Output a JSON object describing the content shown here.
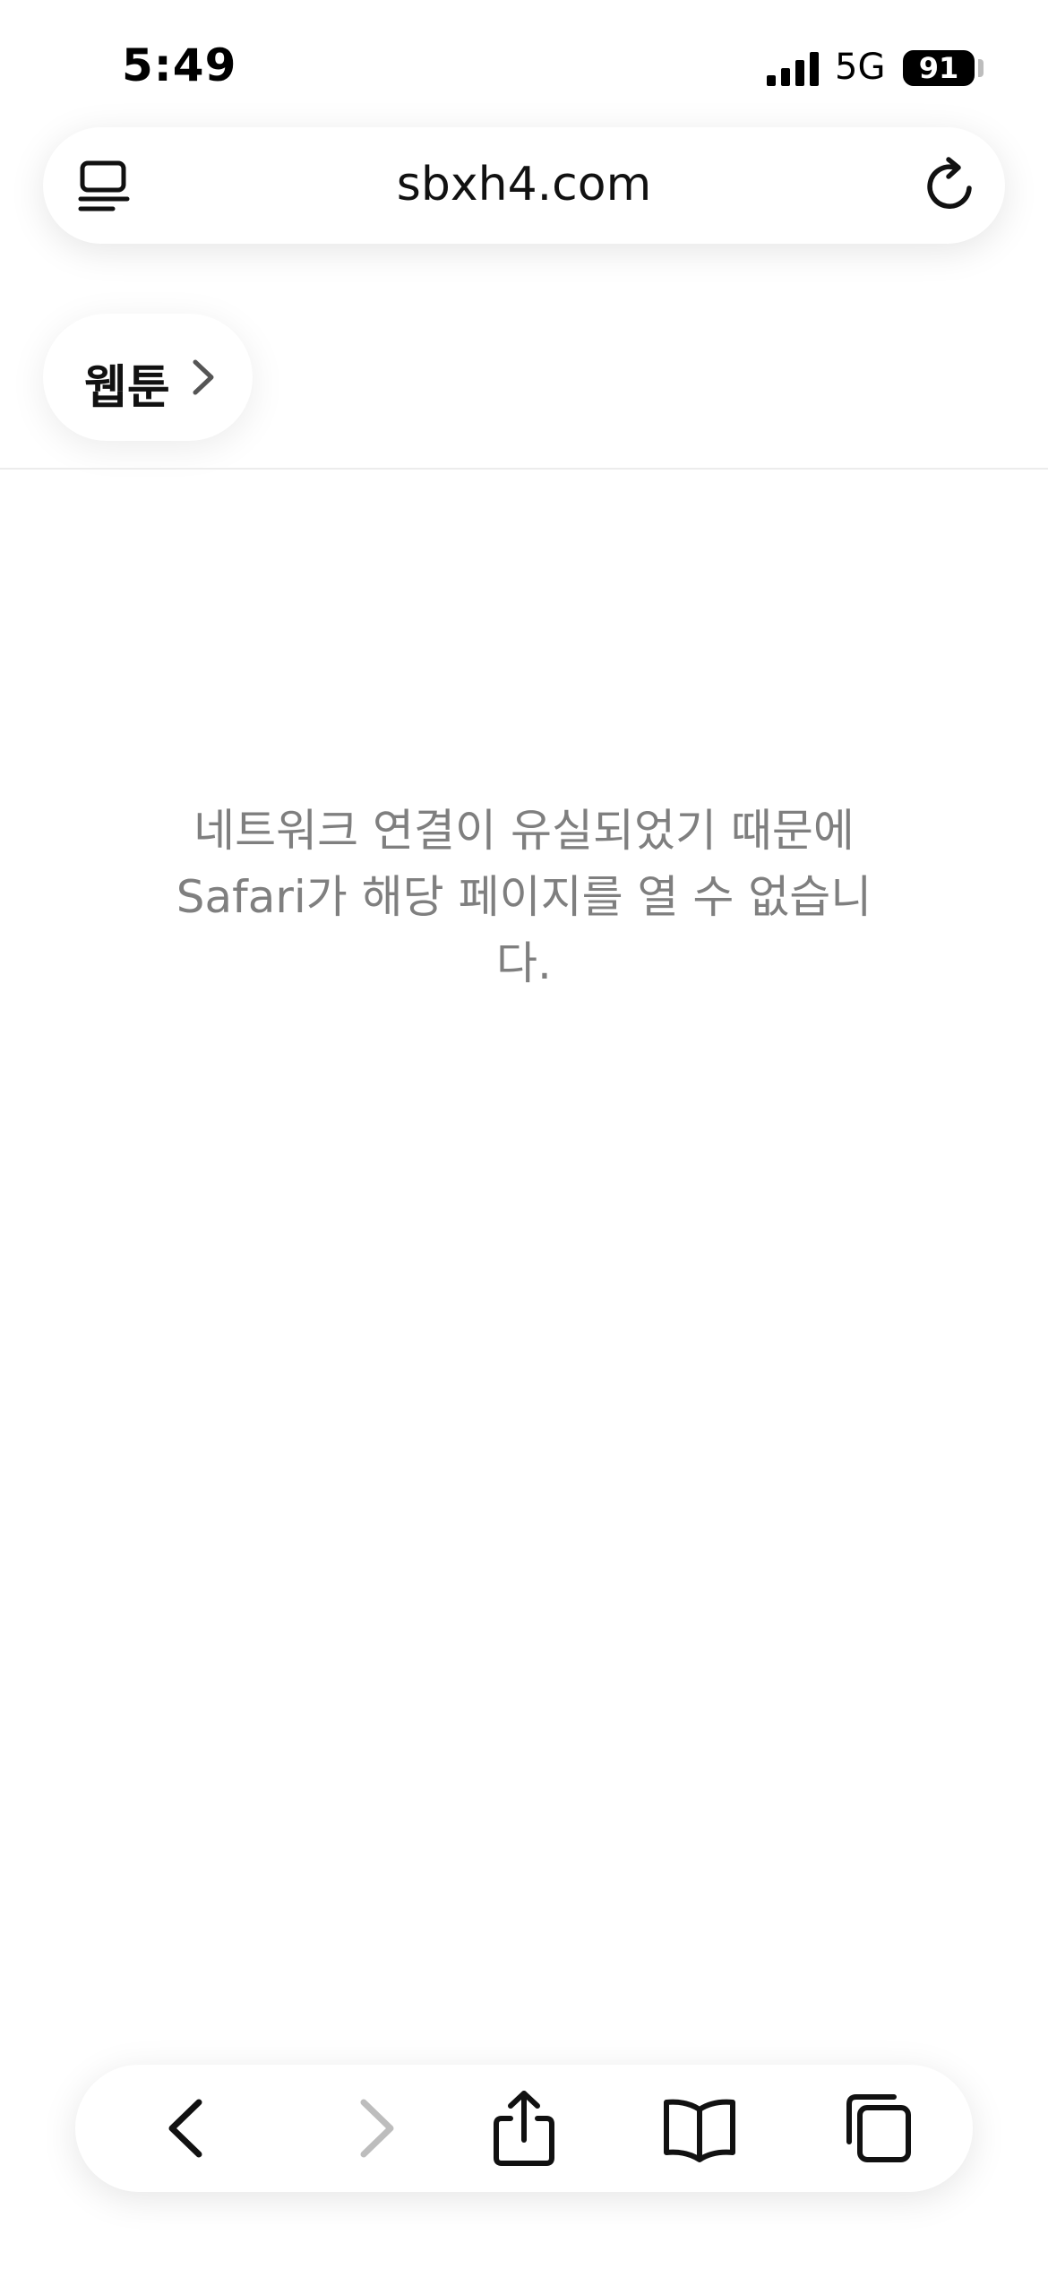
{
  "status_bar": {
    "time": "5:49",
    "network": "5G",
    "battery": "91"
  },
  "address_bar": {
    "url": "sbxh4.com",
    "left_icon": "reader-icon",
    "right_icon": "reload-icon"
  },
  "breadcrumb": {
    "label": "웹툰",
    "icon": "chevron-right-icon"
  },
  "error": {
    "message_line1": "네트워크 연결이 유실되었기 때문에",
    "message_line2": "Safari가 해당 페이지를 열 수 없습니",
    "message_line3": "다."
  },
  "toolbar": {
    "back_icon": "back-icon",
    "forward_icon": "forward-icon",
    "share_icon": "share-icon",
    "bookmarks_icon": "bookmarks-icon",
    "tabs_icon": "tabs-icon",
    "forward_enabled": false
  },
  "colors": {
    "message": "#7f7f7f",
    "disabled_icon": "#bdbdbd",
    "icon": "#111111"
  }
}
